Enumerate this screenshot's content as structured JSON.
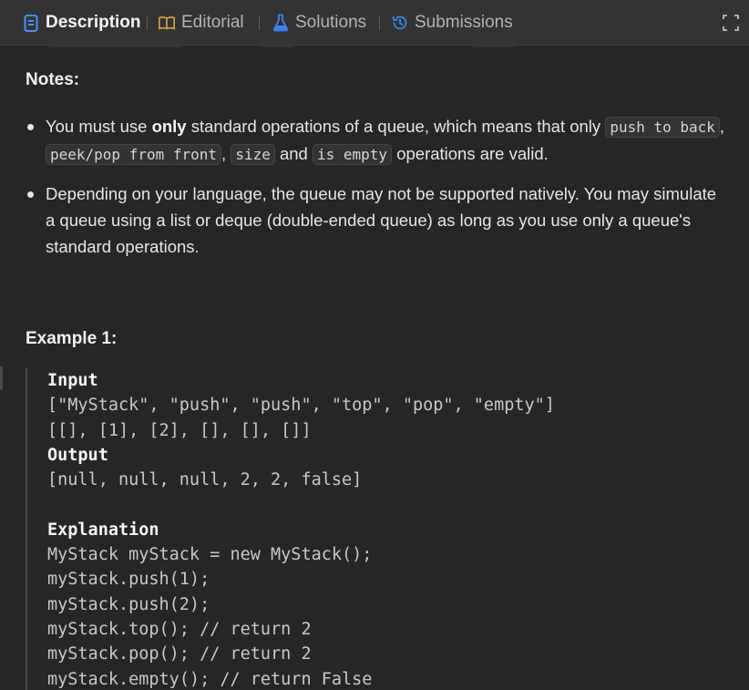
{
  "tabs": [
    {
      "label": "Description",
      "icon": "document-icon",
      "active": true
    },
    {
      "label": "Editorial",
      "icon": "book-icon",
      "active": false
    },
    {
      "label": "Solutions",
      "icon": "flask-icon",
      "active": false
    },
    {
      "label": "Submissions",
      "icon": "history-icon",
      "active": false
    }
  ],
  "colors": {
    "description_icon": "#4c8dff",
    "editorial_icon": "#d9a441",
    "solutions_icon": "#3b82f6",
    "submissions_icon": "#3b82f6"
  },
  "notes": {
    "title": "Notes:",
    "bullet1": {
      "p1": "You must use ",
      "bold": "only",
      "p2": " standard operations of a queue, which means that only ",
      "chip1": "push to back",
      "p3": ", ",
      "chip2": "peek/pop from front",
      "p4": ", ",
      "chip3": "size",
      "p5": " and ",
      "chip4": "is empty",
      "p6": " operations are valid."
    },
    "bullet2": "Depending on your language, the queue may not be supported natively. You may simulate a queue using a list or deque (double-ended queue) as long as you use only a queue's standard operations."
  },
  "example": {
    "title": "Example 1:",
    "input_label": "Input",
    "input_line1": "[\"MyStack\", \"push\", \"push\", \"top\", \"pop\", \"empty\"]",
    "input_line2": "[[], [1], [2], [], [], []]",
    "output_label": "Output",
    "output_line": "[null, null, null, 2, 2, false]",
    "explanation_label": "Explanation",
    "explanation_lines": [
      "MyStack myStack = new MyStack();",
      "myStack.push(1);",
      "myStack.push(2);",
      "myStack.top(); // return 2",
      "myStack.pop(); // return 2",
      "myStack.empty(); // return False"
    ]
  }
}
